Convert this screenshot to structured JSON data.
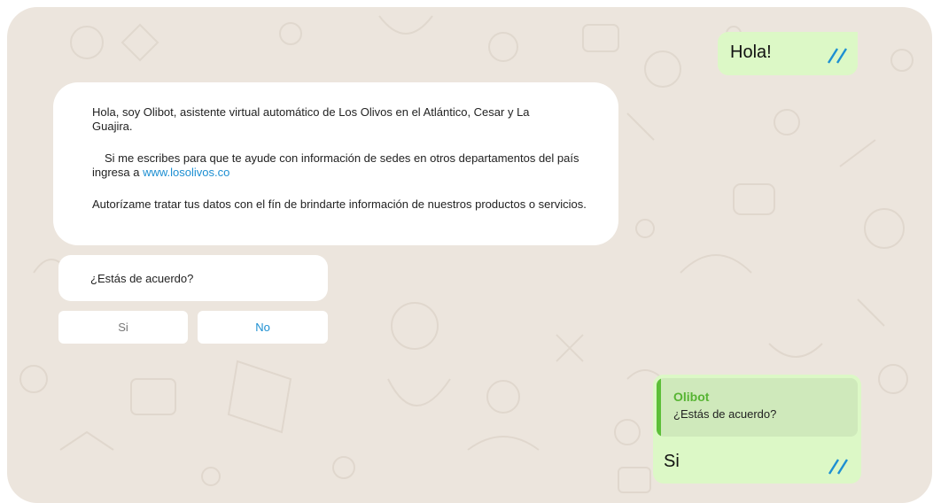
{
  "colors": {
    "chat_background": "#ece5dd",
    "outgoing_bubble": "#dcf8c6",
    "incoming_bubble": "#ffffff",
    "quote_background": "#cfe9bb",
    "quote_accent": "#5cbf38",
    "link": "#1d8fd2",
    "read_tick": "#1d8fd2"
  },
  "messages": {
    "outgoing_greeting": {
      "text": "Hola!",
      "status_icon": "double-check-icon"
    },
    "bot_intro": {
      "paragraph1": "Hola, soy Olibot, asistente virtual automático de Los Olivos en el Atlántico, Cesar y La Guajira.",
      "paragraph2_prefix": "Si me escribes para que te ayude con información de sedes en otros departamentos del país  ingresa a ",
      "paragraph2_link": "www.losolivos.co",
      "paragraph3": "Autorízame tratar tus datos con el fín de brindarte información de nuestros productos o servicios."
    },
    "bot_question": {
      "text": "¿Estás de acuerdo?"
    },
    "quick_replies": [
      {
        "label": "Si"
      },
      {
        "label": "No"
      }
    ],
    "outgoing_reply": {
      "quoted_author": "Olibot",
      "quoted_text": "¿Estás de acuerdo?",
      "text": "Si",
      "status_icon": "double-check-icon"
    }
  }
}
